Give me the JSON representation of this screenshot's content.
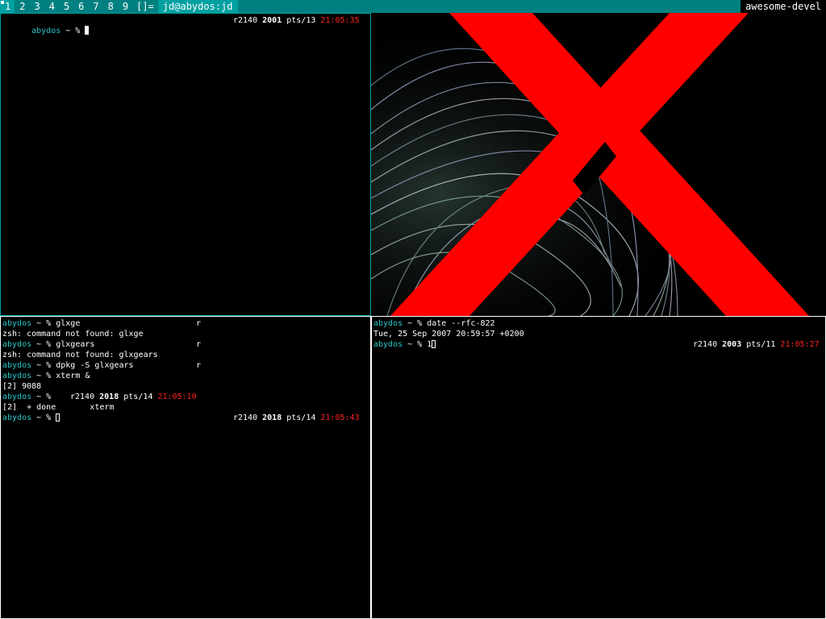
{
  "topbar": {
    "tags": [
      "1",
      "2",
      "3",
      "4",
      "5",
      "6",
      "7",
      "8",
      "9"
    ],
    "active_tag": "1",
    "layout_symbol": "[]=",
    "window_title": "jd@abydos:jd",
    "right_label": "awesome-devel"
  },
  "prompt": {
    "host": "abydos",
    "rest": " ~ % "
  },
  "term_tl": {
    "rprompt": {
      "rev": "r2140",
      "num": "2001",
      "pts": "pts/13",
      "time": "21:05:35"
    }
  },
  "term_bl": {
    "lines": [
      {
        "type": "prompt",
        "cmd": "glxge",
        "tail": "r"
      },
      {
        "type": "out",
        "text": "zsh: command not found: glxge"
      },
      {
        "type": "prompt",
        "cmd": "glxgears",
        "tail": "r"
      },
      {
        "type": "out",
        "text": "zsh: command not found: glxgears"
      },
      {
        "type": "prompt",
        "cmd": "dpkg -S glxgears",
        "tail": "r"
      },
      {
        "type": "prompt",
        "cmd": "xterm &"
      },
      {
        "type": "out",
        "text": "[2] 9088"
      }
    ],
    "mid_rprompt": {
      "rev": "r2140",
      "num": "2018",
      "pts": "pts/14",
      "time": "21:05:10"
    },
    "done_line": "[2]  + done       xterm",
    "rprompt": {
      "rev": "r2140",
      "num": "2018",
      "pts": "pts/14",
      "time": "21:05:43"
    }
  },
  "term_br": {
    "cmd": "date --rfc-822",
    "output": "Tue, 25 Sep 2007 20:59:57 +0200",
    "typed": "1",
    "rprompt": {
      "rev": "r2140",
      "num": "2003",
      "pts": "pts/11",
      "time": "21:05:27"
    }
  },
  "wallpaper": {
    "logo": "X",
    "accent": "#ff0000"
  }
}
